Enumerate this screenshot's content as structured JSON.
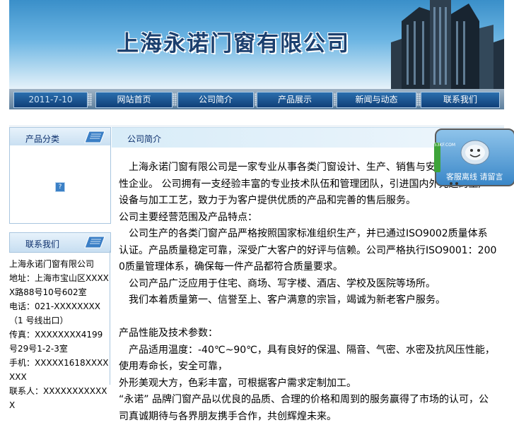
{
  "header": {
    "company_name": "上海永诺门窗有限公司"
  },
  "nav": {
    "date": "2011-7-10",
    "items": [
      "网站首页",
      "公司简介",
      "产品展示",
      "新闻与动态",
      "联系我们"
    ]
  },
  "sidebar": {
    "section1_title": "产品分类",
    "section2_title": "联系我们",
    "contact_lines": [
      "上海永诺门窗有限公司",
      "地址：上海市宝山区XXXXX路88号10号602室",
      "电话：021-XXXXXXXX（1 号线出口）",
      "传真：XXXXXXXX4199号29号1-2-3室",
      "手机：XXXXX1618XXXXXXX",
      "联系人：XXXXXXXXXXXX"
    ]
  },
  "main": {
    "section_title": "公司简介",
    "paragraphs": [
      "　上海永诺门窗有限公司是一家专业从事各类门窗设计、生产、销售与安装服务的综合性企业。 公司拥有一支经验丰富的专业技术队伍和管理团队，引进国内外先进的生产设备与加工工艺，致力于为客户提供优质的产品和完善的售后服务。",
      "公司主要经营范围及产品特点：",
      "　公司生产的各类门窗产品严格按照国家标准组织生产，并已通过ISO9002质量体系认证。产品质量稳定可靠，深受广大客户的好评与信赖。公司严格执行ISO9001：2000质量管理体系，确保每一件产品都符合质量要求。",
      "　公司产品广泛应用于住宅、商场、写字楼、酒店、学校及医院等场所。",
      "　我们本着质量第一、信誉至上、客户满意的宗旨，竭诚为新老客户服务。",
      "",
      "产品性能及技术参数：",
      "　产品适用温度：-40℃~90℃，具有良好的保温、隔音、气密、水密及抗风压性能，使用寿命长，安全可靠，",
      "外形美观大方，色彩丰富，可根据客户需求定制加工。",
      "“永诺” 品牌门窗产品以优良的品质、合理的价格和周到的服务赢得了市场的认可，公司真诚期待与各界朋友携手合作，共创辉煌未来。"
    ]
  },
  "chat_widget": {
    "status_text": "客服离线 请留言",
    "tab_text": "53KF.COM"
  },
  "icons": {
    "book": "book-icon",
    "help": "help-icon",
    "chat_face": "smiley-icon"
  },
  "colors": {
    "banner_blue": "#3a8fc9",
    "nav_dark": "#0f3f78",
    "title_navy": "#1b3f6e",
    "chat_tab_green": "#3ea33a"
  }
}
